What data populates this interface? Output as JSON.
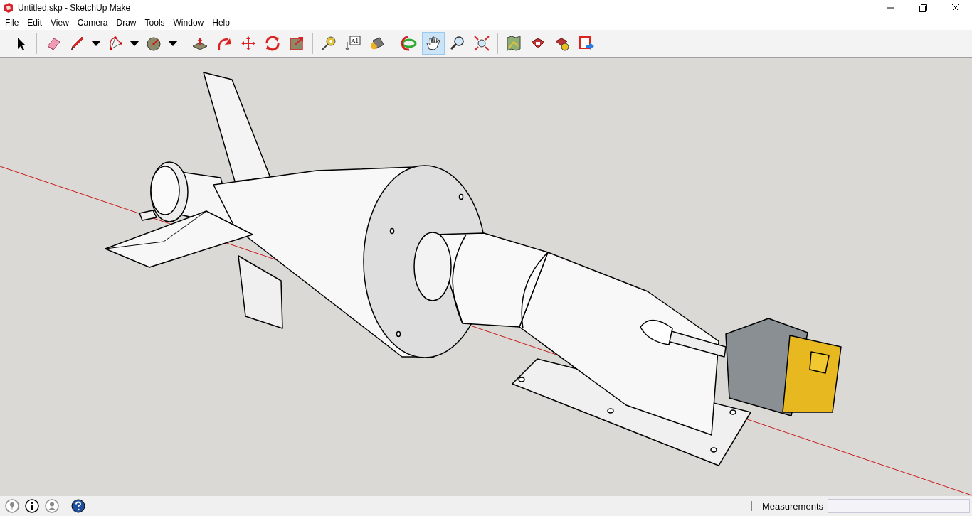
{
  "window": {
    "title": "Untitled.skp - SketchUp Make"
  },
  "menu": [
    "File",
    "Edit",
    "View",
    "Camera",
    "Draw",
    "Tools",
    "Window",
    "Help"
  ],
  "toolbar": [
    {
      "kind": "select",
      "selected": false,
      "dropdown": false
    },
    {
      "kind": "separator"
    },
    {
      "kind": "eraser",
      "selected": false,
      "dropdown": false
    },
    {
      "kind": "pencil",
      "selected": false,
      "dropdown": true
    },
    {
      "kind": "arc",
      "selected": false,
      "dropdown": true
    },
    {
      "kind": "circle",
      "selected": false,
      "dropdown": true
    },
    {
      "kind": "separator"
    },
    {
      "kind": "pushpull",
      "selected": false,
      "dropdown": false
    },
    {
      "kind": "followme",
      "selected": false,
      "dropdown": false
    },
    {
      "kind": "move",
      "selected": false,
      "dropdown": false
    },
    {
      "kind": "rotate",
      "selected": false,
      "dropdown": false
    },
    {
      "kind": "scale",
      "selected": false,
      "dropdown": false
    },
    {
      "kind": "separator"
    },
    {
      "kind": "tape",
      "selected": false,
      "dropdown": false
    },
    {
      "kind": "text",
      "selected": false,
      "dropdown": false,
      "label": "A1"
    },
    {
      "kind": "paint",
      "selected": false,
      "dropdown": false
    },
    {
      "kind": "separator"
    },
    {
      "kind": "orbit",
      "selected": false,
      "dropdown": false
    },
    {
      "kind": "pan",
      "selected": true,
      "dropdown": false
    },
    {
      "kind": "zoom",
      "selected": false,
      "dropdown": false
    },
    {
      "kind": "zoomextents",
      "selected": false,
      "dropdown": false
    },
    {
      "kind": "separator"
    },
    {
      "kind": "map",
      "selected": false,
      "dropdown": false
    },
    {
      "kind": "warehouse",
      "selected": false,
      "dropdown": false
    },
    {
      "kind": "extension",
      "selected": false,
      "dropdown": false
    },
    {
      "kind": "send",
      "selected": false,
      "dropdown": false
    }
  ],
  "status_bar": {
    "measurements_label": "Measurements"
  }
}
